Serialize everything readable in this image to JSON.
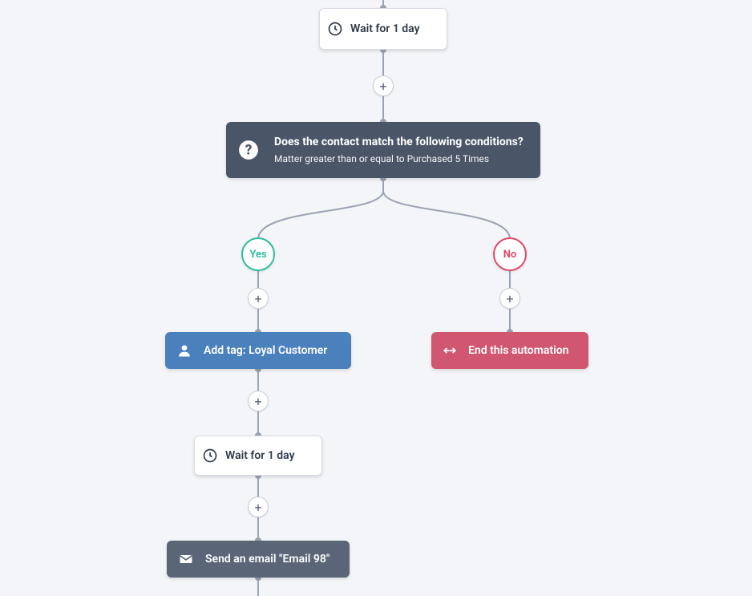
{
  "nodes": {
    "wait1": {
      "label": "Wait for 1 day"
    },
    "condition": {
      "title": "Does the contact match the following conditions?",
      "subtitle": "Matter greater than or equal to Purchased 5 Times"
    },
    "branch_yes": {
      "label": "Yes"
    },
    "branch_no": {
      "label": "No"
    },
    "add_tag": {
      "label": "Add tag: Loyal Customer"
    },
    "end_auto": {
      "label": "End this automation"
    },
    "wait2": {
      "label": "Wait for 1 day"
    },
    "send_email": {
      "label": "Send an email \"Email 98\""
    }
  },
  "add_button_glyph": "+",
  "colors": {
    "background": "#f4f5f8",
    "line": "#9aa3b3",
    "blue": "#4a81bd",
    "slate": "#5a6678",
    "red": "#d15670",
    "yes": "#2fbda0",
    "no": "#e24a6a",
    "dark": "#4a5568"
  }
}
